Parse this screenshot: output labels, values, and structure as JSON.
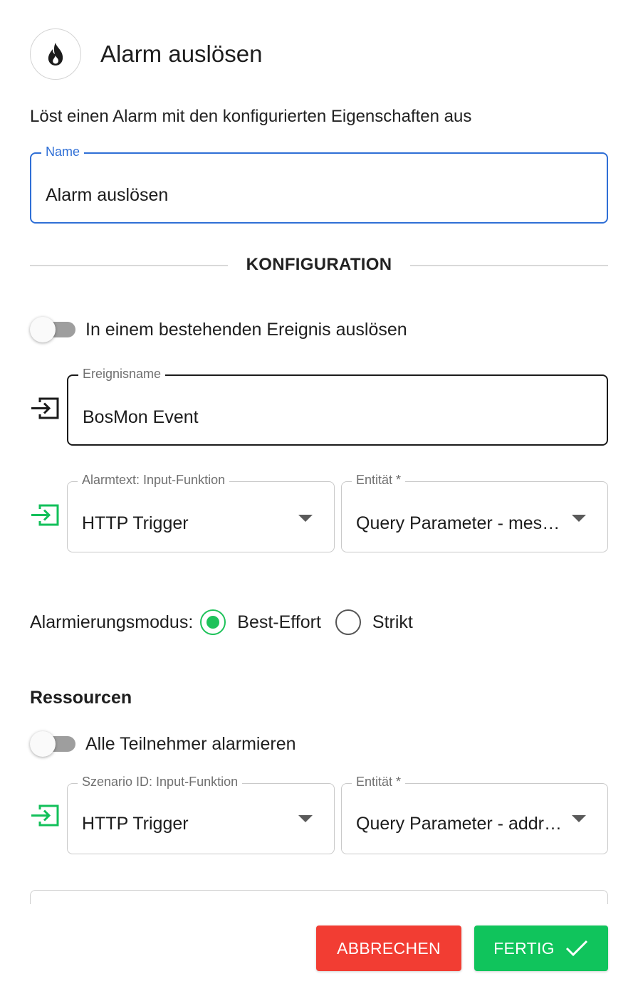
{
  "dialog": {
    "title": "Alarm auslösen",
    "icon": "flame-icon",
    "description": "Löst einen Alarm mit den konfigurierten Eigenschaften aus"
  },
  "name_field": {
    "label": "Name",
    "value": "Alarm auslösen"
  },
  "section_config": "KONFIGURATION",
  "toggle_existing_event": {
    "label": "In einem bestehenden Ereignis auslösen",
    "on": false
  },
  "event_name": {
    "icon": "input-icon",
    "label": "Ereignisname",
    "value": "BosMon Event"
  },
  "alarm_text": {
    "icon": "input-icon",
    "function": {
      "label": "Alarmtext: Input-Funktion",
      "value": "HTTP Trigger"
    },
    "entity": {
      "label": "Entität *",
      "value": "Query Parameter - message"
    }
  },
  "alarm_mode": {
    "label": "Alarmierungsmodus:",
    "options": [
      {
        "label": "Best-Effort",
        "selected": true
      },
      {
        "label": "Strikt",
        "selected": false
      }
    ]
  },
  "resources": {
    "heading": "Ressourcen",
    "toggle_all": {
      "label": "Alle Teilnehmer alarmieren",
      "on": false
    },
    "scenario": {
      "icon": "input-icon",
      "function": {
        "label": "Szenario ID: Input-Funktion",
        "value": "HTTP Trigger"
      },
      "entity": {
        "label": "Entität *",
        "value": "Query Parameter - address"
      }
    }
  },
  "actions": {
    "cancel": "ABBRECHEN",
    "done": "FERTIG",
    "done_icon": "check-icon"
  },
  "colors": {
    "accent_blue": "#2f6fd6",
    "green": "#10c45c",
    "red": "#f23d33"
  }
}
